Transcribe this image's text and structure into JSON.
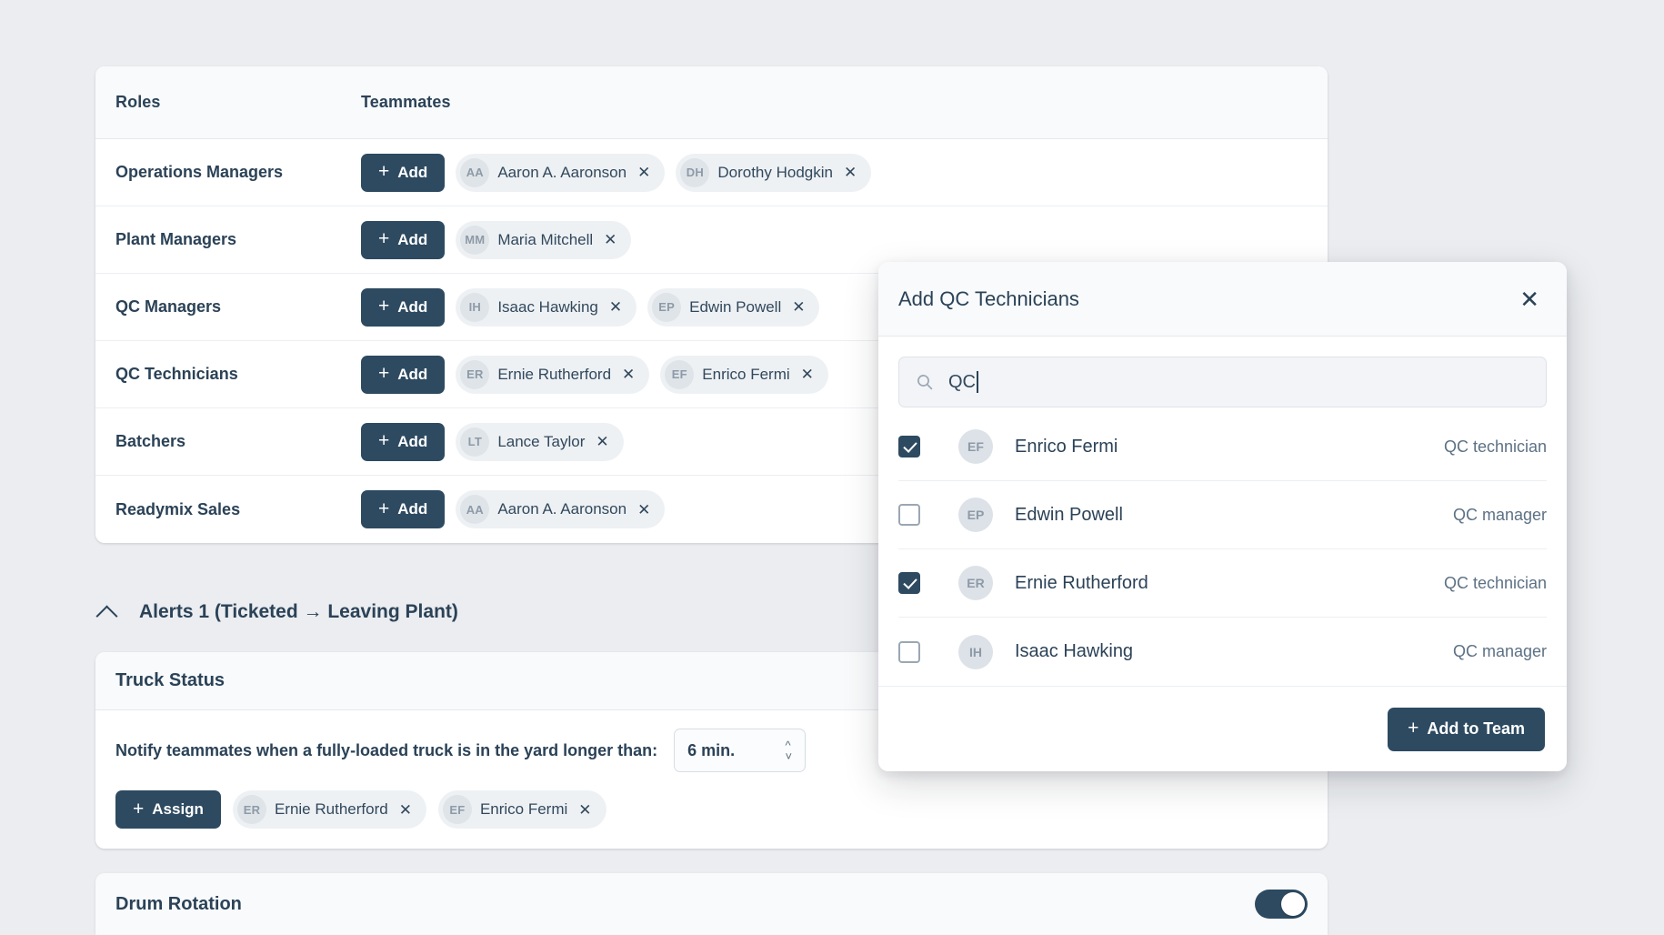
{
  "colors": {
    "page_bg": "#ebedf0",
    "accent_dark": "#2d4a61",
    "text_primary": "#2b4257",
    "chip_bg": "#eef1f4",
    "card_bg": "#ffffff",
    "header_bg": "#f8fafb"
  },
  "roles_table": {
    "columns": {
      "roles": "Roles",
      "teammates": "Teammates"
    },
    "add_label": "Add",
    "rows": [
      {
        "role": "Operations Managers",
        "members": [
          {
            "initials": "AA",
            "name": "Aaron A. Aaronson"
          },
          {
            "initials": "DH",
            "name": "Dorothy Hodgkin"
          }
        ]
      },
      {
        "role": "Plant Managers",
        "members": [
          {
            "initials": "MM",
            "name": "Maria Mitchell"
          }
        ]
      },
      {
        "role": "QC Managers",
        "members": [
          {
            "initials": "IH",
            "name": "Isaac Hawking"
          },
          {
            "initials": "EP",
            "name": "Edwin Powell"
          }
        ]
      },
      {
        "role": "QC Technicians",
        "members": [
          {
            "initials": "ER",
            "name": "Ernie Rutherford"
          },
          {
            "initials": "EF",
            "name": "Enrico Fermi"
          }
        ]
      },
      {
        "role": "Batchers",
        "members": [
          {
            "initials": "LT",
            "name": "Lance Taylor"
          }
        ]
      },
      {
        "role": "Readymix Sales",
        "members": [
          {
            "initials": "AA",
            "name": "Aaron A. Aaronson"
          }
        ]
      }
    ]
  },
  "alerts_section": {
    "title": "Alerts 1 (Ticketed → Leaving Plant)",
    "expanded": true
  },
  "truck_status": {
    "title": "Truck Status",
    "notify_label": "Notify teammates when a fully-loaded truck is in the yard longer than:",
    "duration_value": "6 min.",
    "assign_label": "Assign",
    "assignees": [
      {
        "initials": "ER",
        "name": "Ernie Rutherford"
      },
      {
        "initials": "EF",
        "name": "Enrico Fermi"
      }
    ]
  },
  "drum_rotation": {
    "title": "Drum Rotation",
    "toggle_on": true
  },
  "modal": {
    "title": "Add QC Technicians",
    "close_label": "✕",
    "search": {
      "value": "QC",
      "placeholder": "Search"
    },
    "people": [
      {
        "initials": "EF",
        "name": "Enrico Fermi",
        "role": "QC technician",
        "checked": true
      },
      {
        "initials": "EP",
        "name": "Edwin Powell",
        "role": "QC manager",
        "checked": false
      },
      {
        "initials": "ER",
        "name": "Ernie Rutherford",
        "role": "QC technician",
        "checked": true
      },
      {
        "initials": "IH",
        "name": "Isaac Hawking",
        "role": "QC manager",
        "checked": false
      }
    ],
    "submit_label": "Add to Team"
  }
}
